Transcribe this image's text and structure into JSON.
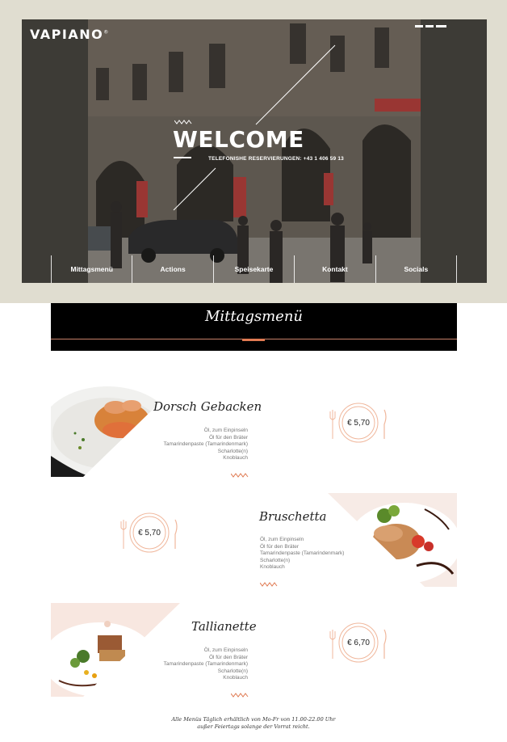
{
  "header": {
    "logo": "VAPIANO",
    "logo_mark": "®",
    "menu_icon": "hamburger-menu-icon"
  },
  "hero": {
    "title": "WELCOME",
    "subtitle": "TELEFONISHE RESERVIERUNGEN: +43 1 406 59 13"
  },
  "nav": {
    "items": [
      {
        "label": "Mittagsmenü"
      },
      {
        "label": "Actions"
      },
      {
        "label": "Speisekarte"
      },
      {
        "label": "Kontakt"
      },
      {
        "label": "Socials"
      }
    ]
  },
  "section": {
    "title": "Mittagsmenü"
  },
  "dishes": [
    {
      "name": "Dorsch Gebacken",
      "description": [
        "Öl, zum Einpinseln",
        "Öl für den Bräter",
        "Tamarindenpaste (Tamarindenmark)",
        "Scharlotte(n)",
        "Knoblauch"
      ],
      "price": "€ 5,70"
    },
    {
      "name": "Bruschetta",
      "description": [
        "Öl, zum Einpinseln",
        "Öl für den Bräter",
        "Tamarindenpaste (Tamarindenmark)",
        "Scharlotte(n)",
        "Knoblauch"
      ],
      "price": "€ 5,70"
    },
    {
      "name": "Tallianette",
      "description": [
        "Öl, zum Einpinseln",
        "Öl für den Bräter",
        "Tamarindenpaste (Tamarindenmark)",
        "Scharlotte(n)",
        "Knoblauch"
      ],
      "price": "€ 6,70"
    }
  ],
  "footer": {
    "line1": "Alle Menüs Täglich erhältlich von Mo-Fr von 11.00-22.00 Uhr",
    "line2": "außer Feiertags solange der Vorrat reicht."
  },
  "colors": {
    "accent": "#e07a52",
    "frame": "#e0ddd0",
    "hero_dark": "#3d3b36",
    "header_bar": "#000000"
  }
}
